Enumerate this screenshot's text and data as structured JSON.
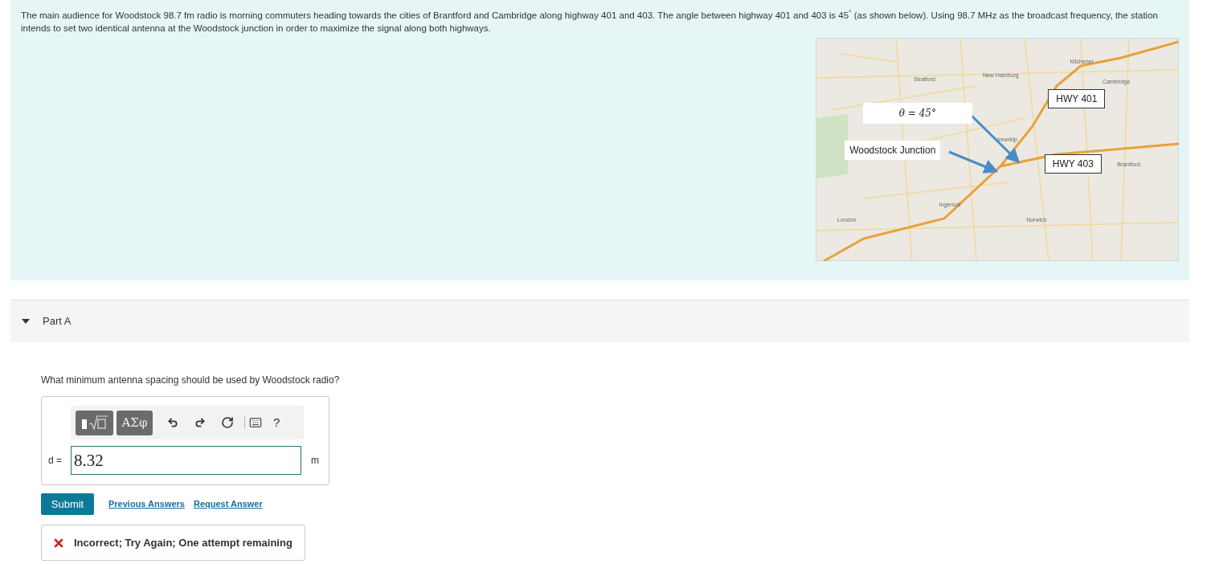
{
  "intro": {
    "text": "The main audience for Woodstock 98.7 fm radio is morning commuters heading towards the cities of Brantford and Cambridge along highway 401 and 403. The angle between highway 401 and 403 is 45$^{°}$ (as shown below). Using 98.7 MHz as the broadcast frequency, the station intends to set two identical antenna at the Woodstock junction in order to maximize the signal along both highways.",
    "map": {
      "places": [
        "Kitchener",
        "Cambridge",
        "Stratford",
        "New Hamburg",
        "Innerkip",
        "Ingersoll",
        "London",
        "Norwich",
        "Brantford"
      ],
      "callouts": [
        {
          "kind": "angle",
          "label": "θ = 45°"
        },
        {
          "kind": "junction",
          "label": "Woodstock Junction"
        },
        {
          "kind": "highway",
          "label": "HWY 401"
        },
        {
          "kind": "highway",
          "label": "HWY 403"
        }
      ]
    }
  },
  "part": {
    "title": "Part A",
    "expanded": true,
    "question": "What minimum antenna spacing should be used by Woodstock radio?",
    "toolbar": {
      "symbols": "ΑΣφ",
      "help": "?"
    },
    "answer": {
      "label": "d =",
      "value": "8.32",
      "unit": "m"
    },
    "submit": "Submit",
    "links": [
      "Previous Answers",
      "Request Answer"
    ],
    "feedback": {
      "kind": "incorrect",
      "text": "Incorrect; Try Again; One attempt remaining"
    }
  }
}
